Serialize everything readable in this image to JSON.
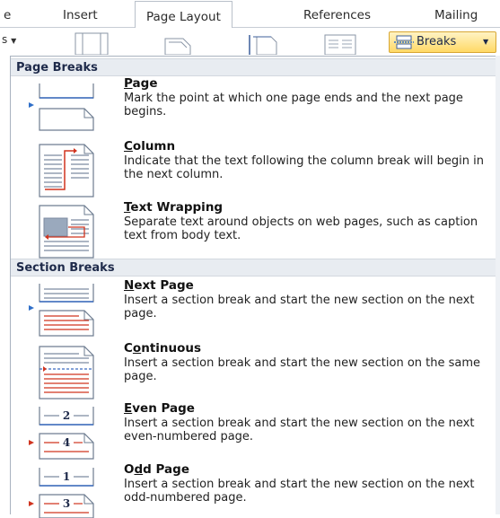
{
  "ribbon": {
    "tabs": [
      {
        "label": "e"
      },
      {
        "label": "Insert"
      },
      {
        "label": "Page Layout"
      },
      {
        "label": "References"
      },
      {
        "label": "Mailing"
      }
    ],
    "size_fragment": "s",
    "breaks_label": "Breaks"
  },
  "menu": {
    "page_breaks_header": "Page Breaks",
    "section_breaks_header": "Section Breaks",
    "items": [
      {
        "mnemonic": "P",
        "title_rest": "age",
        "description": "Mark the point at which one page ends and the next page begins.",
        "icon": "page-break-icon"
      },
      {
        "mnemonic": "C",
        "title_rest": "olumn",
        "description": "Indicate that the text following the column break will begin in the next column.",
        "icon": "column-break-icon"
      },
      {
        "mnemonic": "T",
        "title_rest": "ext Wrapping",
        "description": "Separate text around objects on web pages, such as caption text from body text.",
        "icon": "text-wrapping-icon"
      },
      {
        "mnemonic": "N",
        "title_rest": "ext Page",
        "description": "Insert a section break and start the new section on the next page.",
        "icon": "next-page-icon"
      },
      {
        "mnemonic": "O",
        "title_rest": "ntinuous",
        "title_pre": "C",
        "description": "Insert a section break and start the new section on the same page.",
        "icon": "continuous-icon"
      },
      {
        "mnemonic": "E",
        "title_rest": "ven Page",
        "description": "Insert a section break and start the new section on the next even-numbered page.",
        "icon": "even-page-icon"
      },
      {
        "mnemonic": "D",
        "title_rest": "d Page",
        "title_pre": "O",
        "description": "Insert a section break and start the new section on the next odd-numbered page.",
        "icon": "odd-page-icon"
      }
    ],
    "even_numbers": [
      "2",
      "4"
    ],
    "odd_numbers": [
      "1",
      "3"
    ]
  },
  "colors": {
    "accent_blue": "#2f6fc9",
    "accent_red": "#d0341f",
    "header_bg": "#e8ecf1",
    "breaks_highlight": "#ffd966"
  }
}
